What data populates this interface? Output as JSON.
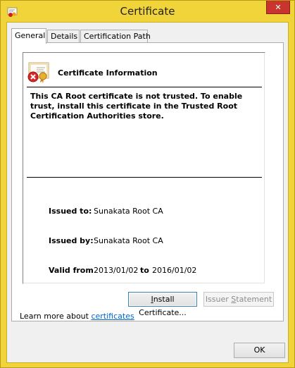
{
  "window": {
    "title": "Certificate",
    "close_glyph": "✕",
    "app_icon": "certificate-icon"
  },
  "tabs": [
    {
      "label": "General",
      "active": true
    },
    {
      "label": "Details",
      "active": false
    },
    {
      "label": "Certification Path",
      "active": false
    }
  ],
  "info": {
    "title": "Certificate Information",
    "warning": "This CA Root certificate is not trusted. To enable trust, install this certificate in the Trusted Root Certification Authorities store.",
    "issued_to_label": "Issued to:",
    "issued_to_value": "Sunakata Root CA",
    "issued_by_label": "Issued by:",
    "issued_by_value": "Sunakata Root CA",
    "valid_from_label": "Valid from",
    "valid_from_value": "2013/01/02",
    "valid_to_label": "to",
    "valid_to_value": "2016/01/02",
    "icon": "certificate-error-icon"
  },
  "buttons": {
    "install_pre": "I",
    "install_rest": "nstall Certificate...",
    "issuer_pre": "Issuer ",
    "issuer_u": "S",
    "issuer_rest": "tatement",
    "ok": "OK"
  },
  "learn": {
    "prefix": "Learn more about ",
    "link": "certificates"
  },
  "colors": {
    "frame": "#f0d43a",
    "close": "#c7352c",
    "link": "#0066cc"
  }
}
